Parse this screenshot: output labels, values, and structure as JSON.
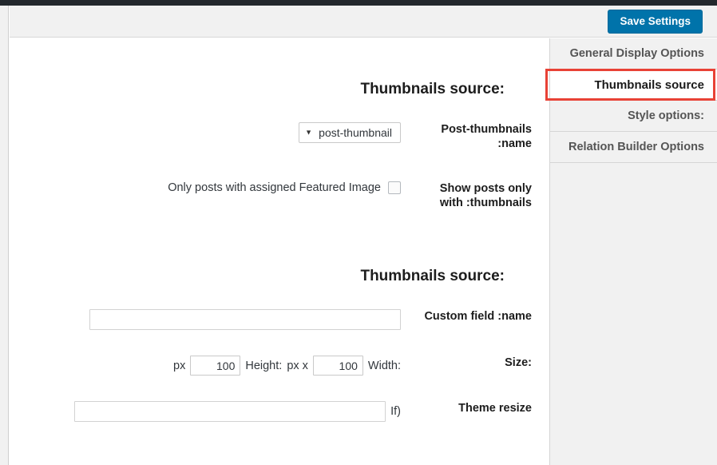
{
  "toolbar": {
    "save_label": "Save Settings"
  },
  "sidebar": {
    "tabs": [
      {
        "label": "General Display Options",
        "active": false
      },
      {
        "label": "Thumbnails source",
        "active": true
      },
      {
        "label": ":Style options",
        "active": false
      },
      {
        "label": "Relation Builder Options",
        "active": false
      }
    ]
  },
  "content": {
    "section_one": {
      "heading": ":Thumbnails source",
      "rows": [
        {
          "label": "Post-thumbnails :name",
          "select_value": "post-thumbnail",
          "caret": "▼"
        },
        {
          "label": "Show posts only with :thumbnails",
          "checkbox_label": "Only posts with assigned Featured Image",
          "checked": false
        }
      ]
    },
    "section_two": {
      "heading": ":Thumbnails source",
      "custom_field": {
        "label": "Custom field :name",
        "value": ""
      },
      "size": {
        "label": ":Size",
        "width_prefix": "Width:",
        "width_value": "100",
        "width_unit": "px x",
        "height_prefix": "Height:",
        "height_value": "100",
        "height_unit": "px"
      },
      "theme_resize": {
        "label": "Theme resize",
        "prefix": "If)",
        "value": ""
      }
    }
  },
  "colors": {
    "adminbar": "#23282d",
    "accent_button": "#0073aa",
    "highlight_box": "#e84236",
    "panel_bg": "#f1f1f1"
  }
}
